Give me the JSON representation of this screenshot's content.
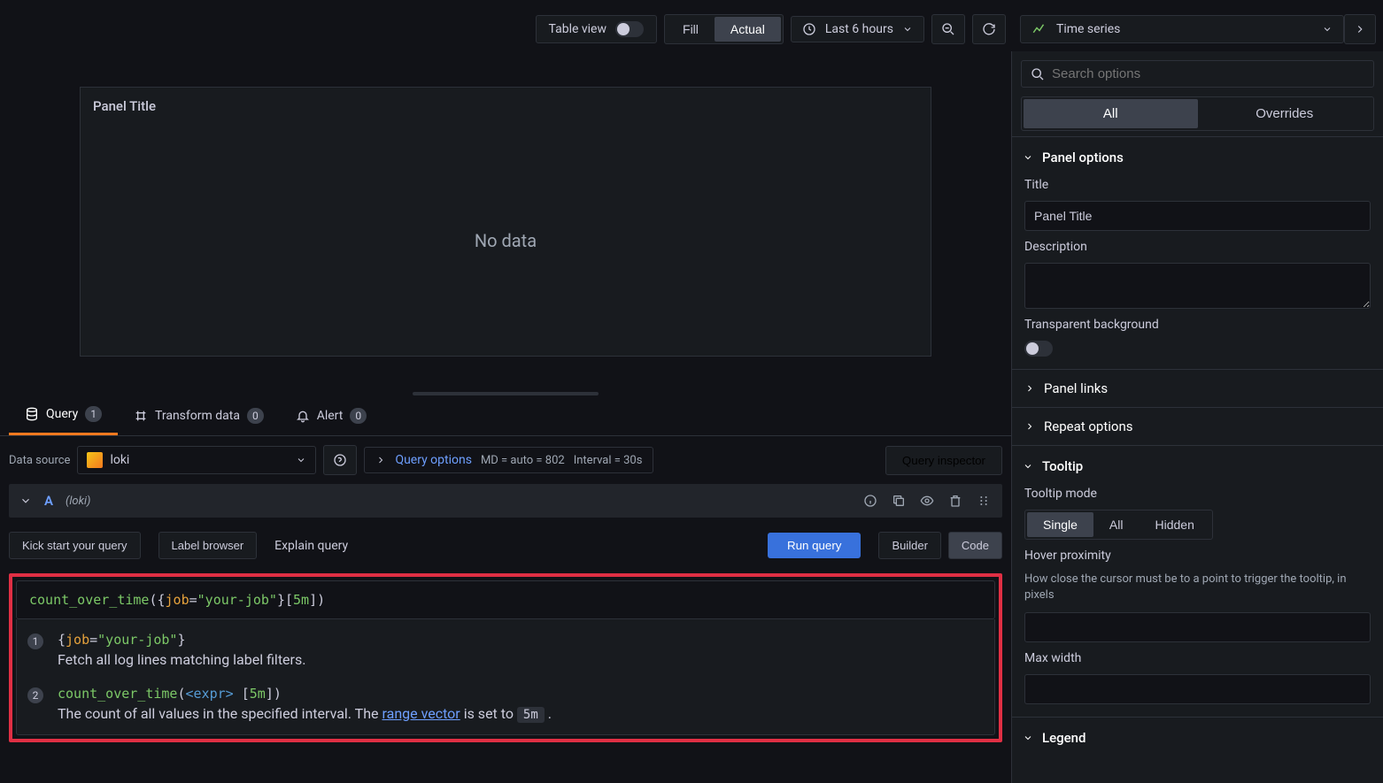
{
  "topbar": {
    "table_view_label": "Table view",
    "fill_label": "Fill",
    "actual_label": "Actual",
    "time_range": "Last 6 hours",
    "vis_type": "Time series"
  },
  "panel": {
    "title": "Panel Title",
    "empty_state": "No data"
  },
  "tabs": {
    "query": "Query",
    "query_count": "1",
    "transform": "Transform data",
    "transform_count": "0",
    "alert": "Alert",
    "alert_count": "0"
  },
  "data_source": {
    "label": "Data source",
    "selected": "loki"
  },
  "query_options": {
    "link_label": "Query options",
    "md": "MD = auto = 802",
    "interval": "Interval = 30s",
    "inspector": "Query inspector"
  },
  "query_row": {
    "id": "A",
    "subtitle": "(loki)",
    "kickstart": "Kick start your query",
    "label_browser": "Label browser",
    "explain": "Explain query",
    "run": "Run query",
    "builder": "Builder",
    "code": "Code"
  },
  "code_input": {
    "fn": "count_over_time",
    "open": "({",
    "key": "job",
    "eq": "=",
    "str": "\"your-job\"",
    "close1": "}[",
    "dur": "5m",
    "close2": "])"
  },
  "explain_list": {
    "item1": {
      "num": "1",
      "open": "{",
      "key": "job",
      "eq": "=",
      "str": "\"your-job\"",
      "close": "}",
      "desc": "Fetch all log lines matching label filters."
    },
    "item2": {
      "num": "2",
      "fn": "count_over_time",
      "open": "(",
      "arg": "<expr>",
      "sp": " [",
      "dur": "5m",
      "close": "])",
      "desc_pre": "The count of all values in the specified interval. The ",
      "link": "range vector",
      "desc_mid": " is set to ",
      "kbd": "5m",
      "dot": " ."
    }
  },
  "sidebar": {
    "search_placeholder": "Search options",
    "tab_all": "All",
    "tab_overrides": "Overrides",
    "panel_options": {
      "heading": "Panel options",
      "title_label": "Title",
      "title_value": "Panel Title",
      "desc_label": "Description",
      "transparent_label": "Transparent background",
      "panel_links": "Panel links",
      "repeat_options": "Repeat options"
    },
    "tooltip": {
      "heading": "Tooltip",
      "mode_label": "Tooltip mode",
      "modes": {
        "single": "Single",
        "all": "All",
        "hidden": "Hidden"
      },
      "hover_label": "Hover proximity",
      "hover_help": "How close the cursor must be to a point to trigger the tooltip, in pixels",
      "maxwidth_label": "Max width"
    },
    "legend": "Legend"
  }
}
